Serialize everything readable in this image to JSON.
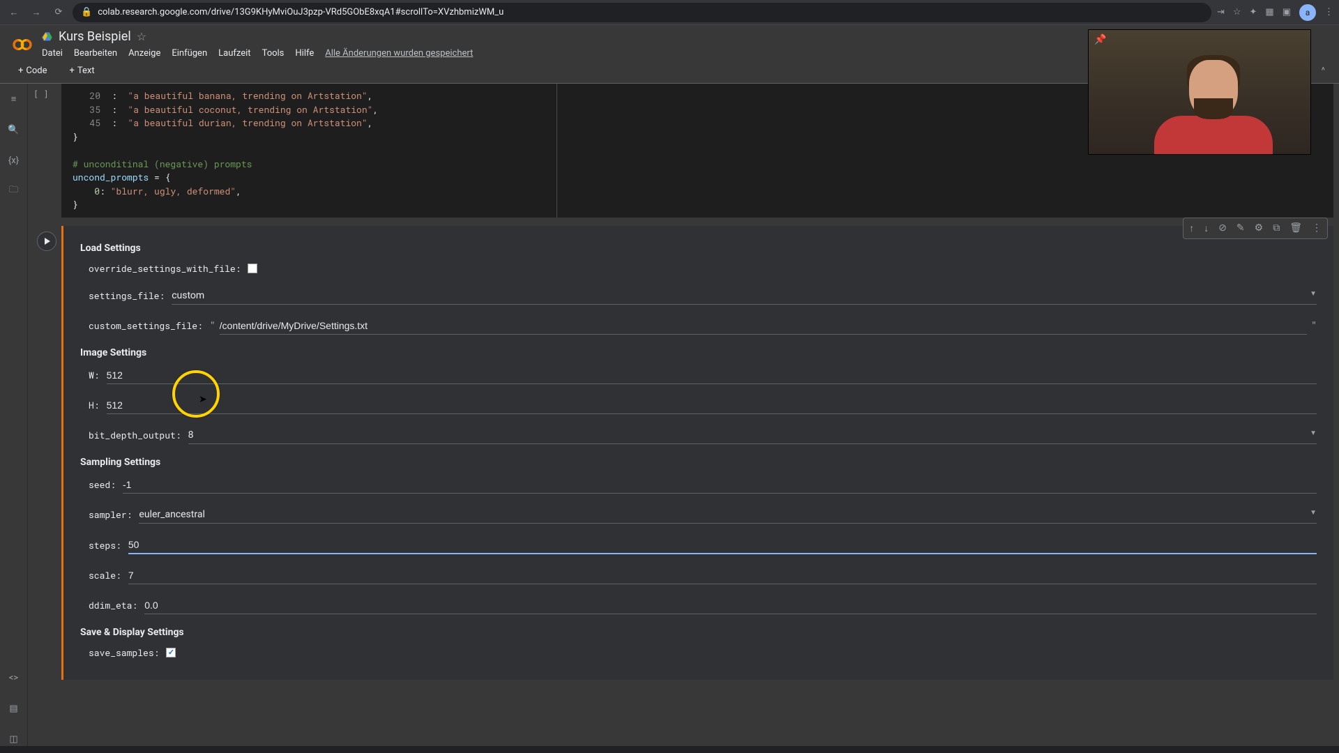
{
  "browser": {
    "url": "colab.research.google.com/drive/13G9KHyMviOuJ3pzp-VRd5GObE8xqA1#scrollTo=XVzhbmizWM_u",
    "avatar_initial": "a"
  },
  "header": {
    "title": "Kurs Beispiel",
    "menu": {
      "file": "Datei",
      "edit": "Bearbeiten",
      "view": "Anzeige",
      "insert": "Einfügen",
      "runtime": "Laufzeit",
      "tools": "Tools",
      "help": "Hilfe",
      "saved": "Alle Änderungen wurden gespeichert"
    }
  },
  "toolbar": {
    "code": "Code",
    "text": "Text"
  },
  "code_cell": {
    "bracket": "[ ]",
    "lines": [
      {
        "num": "20",
        "text": "\"a beautiful banana, trending on Artstation\","
      },
      {
        "num": "35",
        "text": "\"a beautiful coconut, trending on Artstation\","
      },
      {
        "num": "45",
        "text": "\"a beautiful durian, trending on Artstation\","
      },
      {
        "num": "",
        "text": "}"
      },
      {
        "num": "",
        "text": ""
      },
      {
        "num": "",
        "text": "# unconditinal (negative) prompts"
      },
      {
        "num": "",
        "text": "uncond_prompts = {"
      },
      {
        "num": "0",
        "text": "\"blurr, ugly, deformed\","
      },
      {
        "num": "",
        "text": "}"
      }
    ]
  },
  "form": {
    "load_settings": {
      "title": "Load Settings",
      "override_label": "override_settings_with_file:",
      "override_checked": false,
      "settings_file_label": "settings_file:",
      "settings_file_value": "custom",
      "custom_file_label": "custom_settings_file:",
      "custom_file_value": "/content/drive/MyDrive/Settings.txt"
    },
    "image_settings": {
      "title": "Image Settings",
      "w_label": "W:",
      "w_value": "512",
      "h_label": "H:",
      "h_value": "512",
      "bit_depth_label": "bit_depth_output:",
      "bit_depth_value": "8"
    },
    "sampling_settings": {
      "title": "Sampling Settings",
      "seed_label": "seed:",
      "seed_value": "-1",
      "sampler_label": "sampler:",
      "sampler_value": "euler_ancestral",
      "steps_label": "steps:",
      "steps_value": "50",
      "scale_label": "scale:",
      "scale_value": "7",
      "ddim_eta_label": "ddim_eta:",
      "ddim_eta_value": "0.0"
    },
    "save_display": {
      "title": "Save & Display Settings",
      "save_samples_label": "save_samples:",
      "save_samples_checked": true
    }
  }
}
